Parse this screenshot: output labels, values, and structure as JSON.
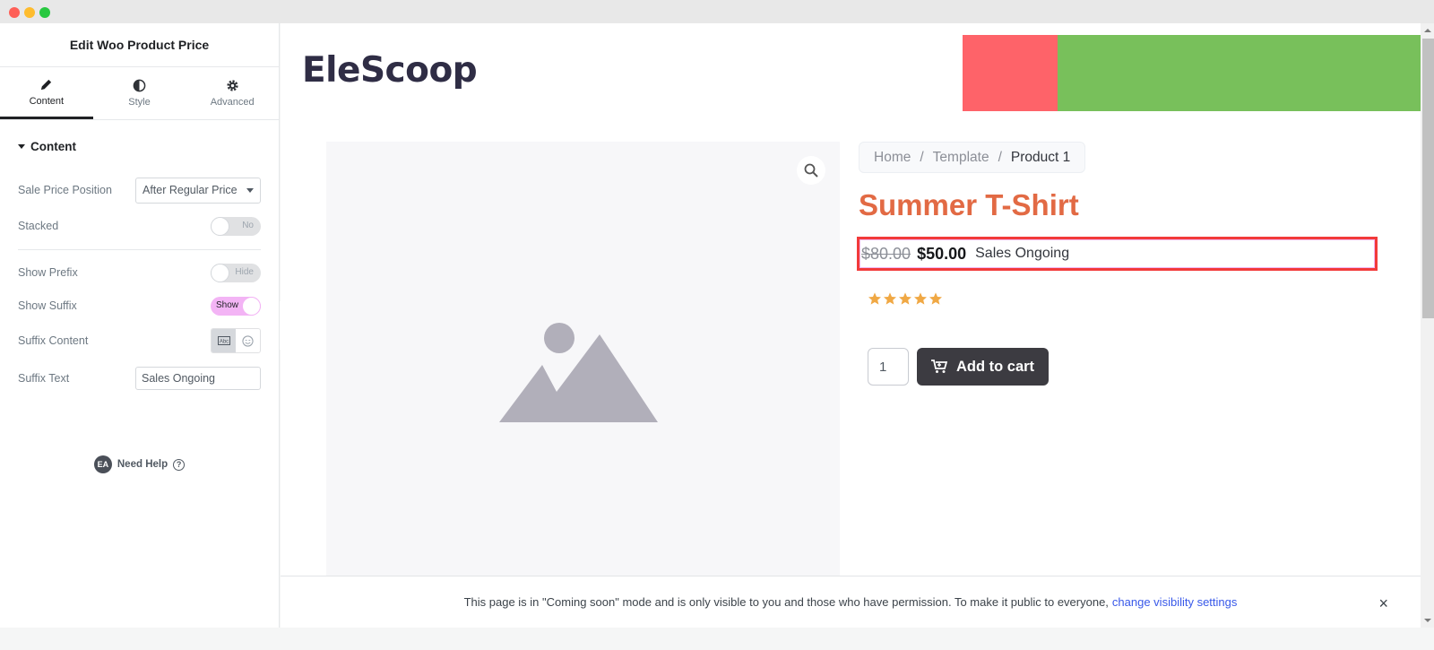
{
  "panel": {
    "title": "Edit Woo Product Price",
    "tabs": [
      {
        "label": "Content",
        "icon": "pencil-icon",
        "active": true
      },
      {
        "label": "Style",
        "icon": "half-circle-icon",
        "active": false
      },
      {
        "label": "Advanced",
        "icon": "gear-icon",
        "active": false
      }
    ],
    "section_title": "Content",
    "controls": {
      "sale_price_position": {
        "label": "Sale Price Position",
        "value": "After Regular Price"
      },
      "stacked": {
        "label": "Stacked",
        "state": "No"
      },
      "show_prefix": {
        "label": "Show Prefix",
        "state": "Hide"
      },
      "show_suffix": {
        "label": "Show Suffix",
        "state": "Show"
      },
      "suffix_content": {
        "label": "Suffix Content",
        "options": [
          "text-icon",
          "emoji-icon"
        ],
        "selected": "text-icon"
      },
      "suffix_text": {
        "label": "Suffix Text",
        "value": "Sales Ongoing"
      }
    },
    "help": {
      "badge": "EA",
      "label": "Need Help",
      "icon": "question-icon"
    }
  },
  "preview": {
    "logo": "EleScoop",
    "banner_colors": [
      "#fe6369",
      "#78c05b"
    ],
    "breadcrumb": [
      "Home",
      "Template",
      "Product 1"
    ],
    "breadcrumb_separator": "/",
    "product_title": "Summer T-Shirt",
    "price": {
      "regular": "$80.00",
      "sale": "$50.00",
      "suffix": "Sales Ongoing"
    },
    "rating": {
      "stars": 5,
      "max": 5,
      "color": "#f0a844"
    },
    "quantity": "1",
    "add_to_cart": "Add to cart",
    "title_color": "#e26a44",
    "highlight_color": "#f23a3a"
  },
  "notice": {
    "text": "This page is in \"Coming soon\" mode and is only visible to you and those who have permission. To make it public to everyone,",
    "link": "change visibility settings",
    "close": "×"
  }
}
